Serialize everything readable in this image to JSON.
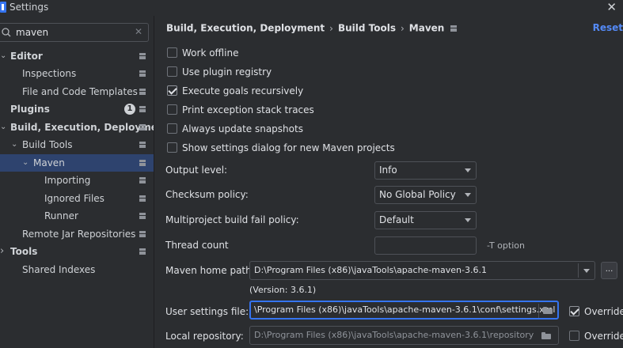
{
  "window": {
    "title": "Settings",
    "close_glyph": "✕"
  },
  "sidebar": {
    "search": {
      "value": "maven",
      "clear_glyph": "✕"
    },
    "items": [
      {
        "label": "Editor",
        "arrow": "⌄"
      },
      {
        "label": "Inspections"
      },
      {
        "label": "File and Code Templates"
      },
      {
        "label": "Plugins",
        "badge": "1"
      },
      {
        "label": "Build, Execution, Deployment",
        "arrow": "⌄"
      },
      {
        "label": "Build Tools",
        "arrow": "⌄"
      },
      {
        "label": "Maven",
        "arrow": "⌄",
        "selected": true
      },
      {
        "label": "Importing"
      },
      {
        "label": "Ignored Files"
      },
      {
        "label": "Runner"
      },
      {
        "label": "Remote Jar Repositories"
      },
      {
        "label": "Tools",
        "arrow": "›"
      },
      {
        "label": "Shared Indexes"
      }
    ]
  },
  "header": {
    "breadcrumb": [
      "Build, Execution, Deployment",
      "Build Tools",
      "Maven"
    ],
    "separator": "›",
    "reset_label": "Reset"
  },
  "checkboxes": [
    {
      "label": "Work offline",
      "checked": false
    },
    {
      "label": "Use plugin registry",
      "checked": false
    },
    {
      "label": "Execute goals recursively",
      "checked": true
    },
    {
      "label": "Print exception stack traces",
      "checked": false
    },
    {
      "label": "Always update snapshots",
      "checked": false
    },
    {
      "label": "Show settings dialog for new Maven projects",
      "checked": false
    }
  ],
  "fields": {
    "output_level": {
      "label": "Output level:",
      "value": "Info"
    },
    "checksum_policy": {
      "label": "Checksum policy:",
      "value": "No Global Policy"
    },
    "fail_policy": {
      "label": "Multiproject build fail policy:",
      "value": "Default"
    },
    "thread_count": {
      "label": "Thread count",
      "value": "",
      "hint": "-T option"
    },
    "maven_home": {
      "label": "Maven home path:",
      "value": "D:\\Program Files (x86)\\javaTools\\apache-maven-3.6.1",
      "browse_label": "...",
      "version": "(Version: 3.6.1)"
    },
    "user_settings": {
      "label": "User settings file:",
      "value": "\\Program Files (x86)\\javaTools\\apache-maven-3.6.1\\conf\\settings.xml",
      "override_label": "Override",
      "override_checked": true
    },
    "local_repo": {
      "label": "Local repository:",
      "value": "D:\\Program Files (x86)\\javaTools\\apache-maven-3.6.1\\repository",
      "override_label": "Override",
      "override_checked": false
    }
  }
}
